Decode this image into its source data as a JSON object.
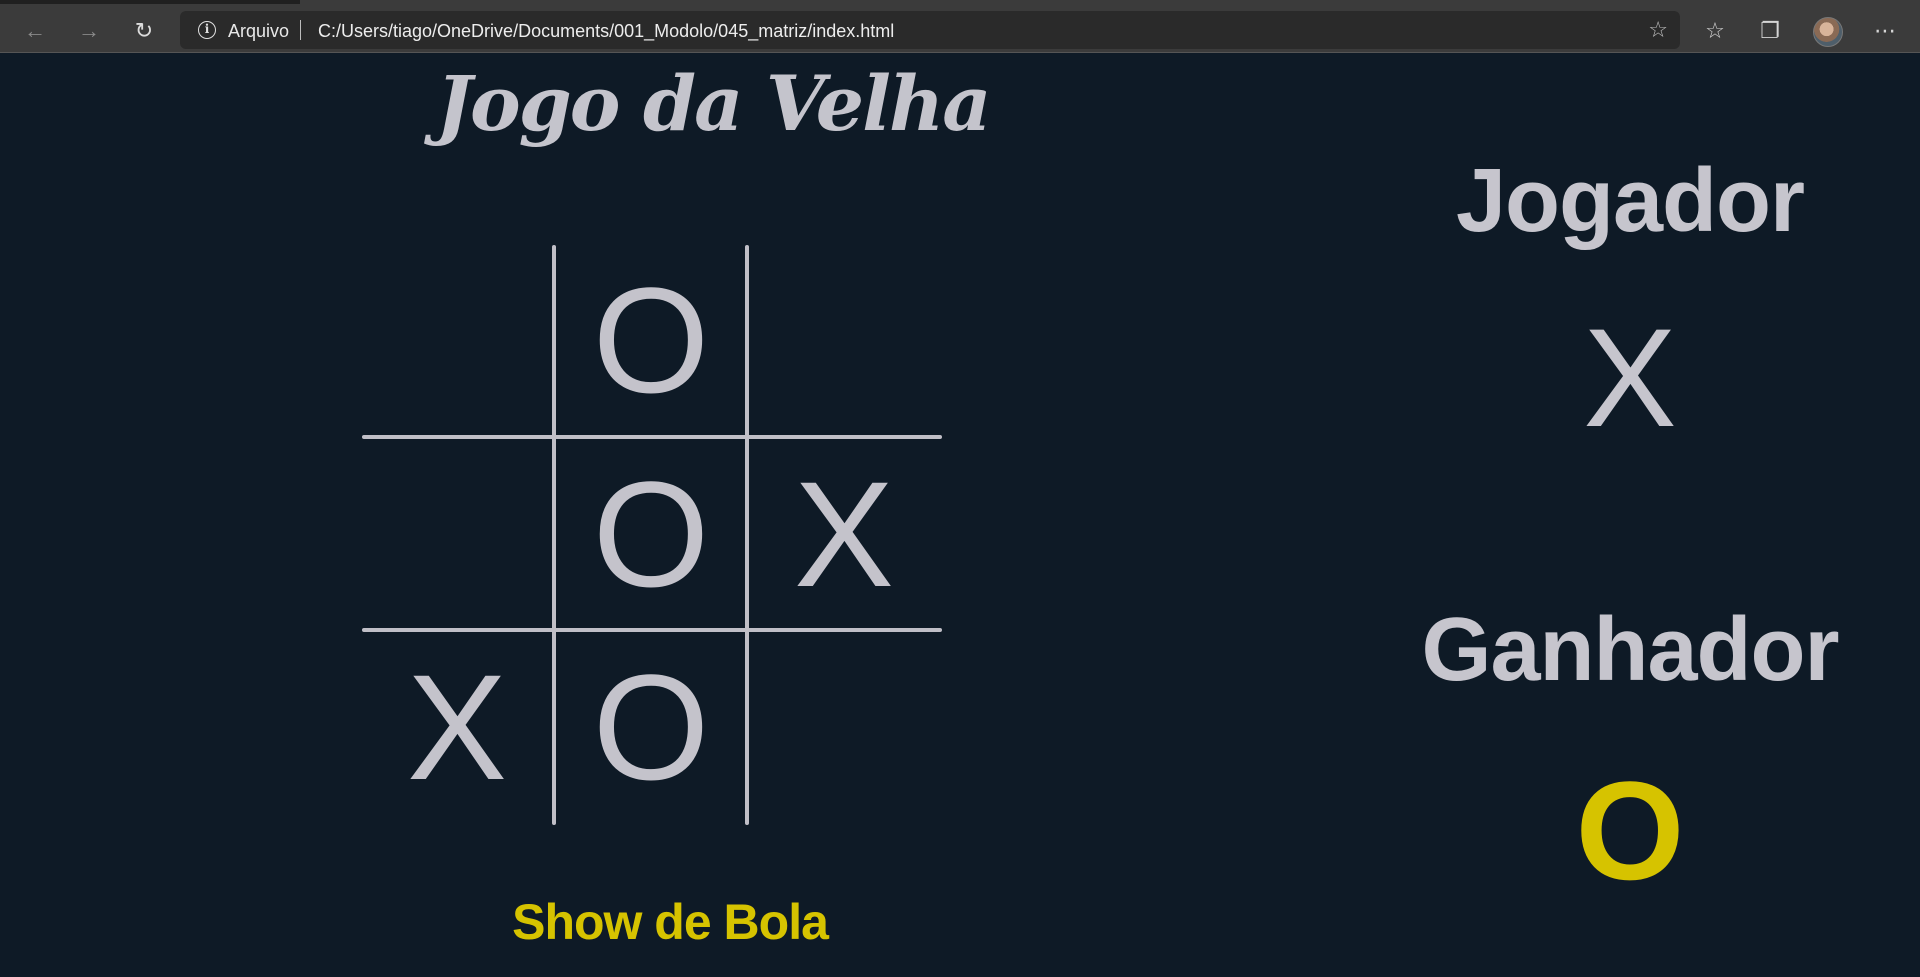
{
  "browser": {
    "site_label": "Arquivo",
    "url": "C:/Users/tiago/OneDrive/Documents/001_Modolo/045_matriz/index.html"
  },
  "game": {
    "title": "Jogo da Velha",
    "board": [
      [
        "",
        "O",
        ""
      ],
      [
        "",
        "O",
        "X"
      ],
      [
        "X",
        "O",
        ""
      ]
    ],
    "footer": "Show de Bola"
  },
  "status": {
    "player_heading": "Jogador",
    "current_player": "X",
    "winner_heading": "Ganhador",
    "winner": "O"
  },
  "colors": {
    "background": "#0e1a26",
    "accent": "#d6c300",
    "foreground": "#c4c3cb"
  }
}
